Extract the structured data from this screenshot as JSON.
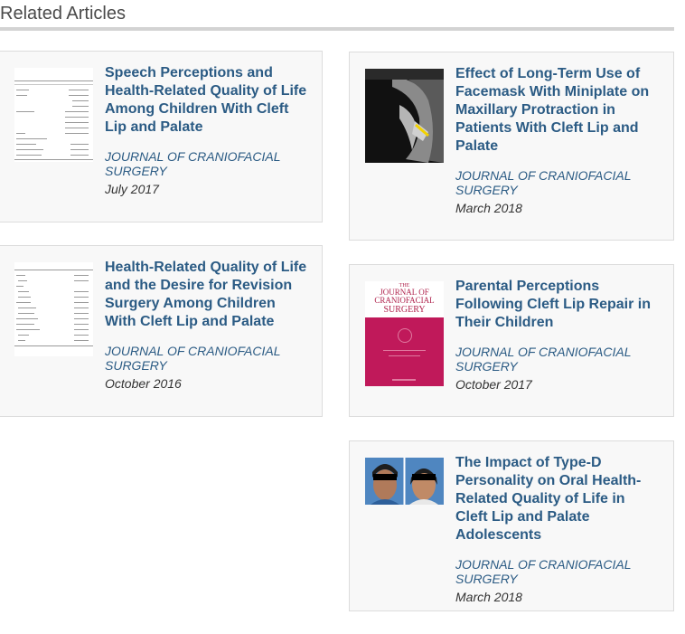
{
  "section": {
    "title": "Related Articles"
  },
  "articles": [
    {
      "title": "Speech Perceptions and Health-Related Quality of Life Among Children With Cleft Lip and Palate",
      "journal": "JOURNAL OF CRANIOFACIAL SURGERY",
      "date": "July 2017",
      "thumbnail": "table-thumbnail"
    },
    {
      "title": "Effect of Long-Term Use of Facemask With Miniplate on Maxillary Protraction in Patients With Cleft Lip and Palate",
      "journal": "JOURNAL OF CRANIOFACIAL SURGERY",
      "date": "March 2018",
      "thumbnail": "xray-thumbnail"
    },
    {
      "title": "Health-Related Quality of Life and the Desire for Revision Surgery Among Children With Cleft Lip and Palate",
      "journal": "JOURNAL OF CRANIOFACIAL SURGERY",
      "date": "October 2016",
      "thumbnail": "table-thumbnail"
    },
    {
      "title": "Parental Perceptions Following Cleft Lip Repair in Their Children",
      "journal": "JOURNAL OF CRANIOFACIAL SURGERY",
      "date": "October 2017",
      "thumbnail": "journal-cover-thumbnail",
      "cover": {
        "the": "THE",
        "journal": "JOURNAL OF CRANIOFACIAL",
        "surgery": "SURGERY"
      }
    },
    {
      "title": "The Impact of Type-D Personality on Oral Health-Related Quality of Life in Cleft Lip and Palate Adolescents",
      "journal": "JOURNAL OF CRANIOFACIAL SURGERY",
      "date": "March 2018",
      "thumbnail": "patient-photo-thumbnail"
    }
  ],
  "colors": {
    "link": "#2b5b84",
    "card_bg": "#f8f8f8",
    "card_border": "#dcdcdc",
    "cover": "#c0195a"
  }
}
